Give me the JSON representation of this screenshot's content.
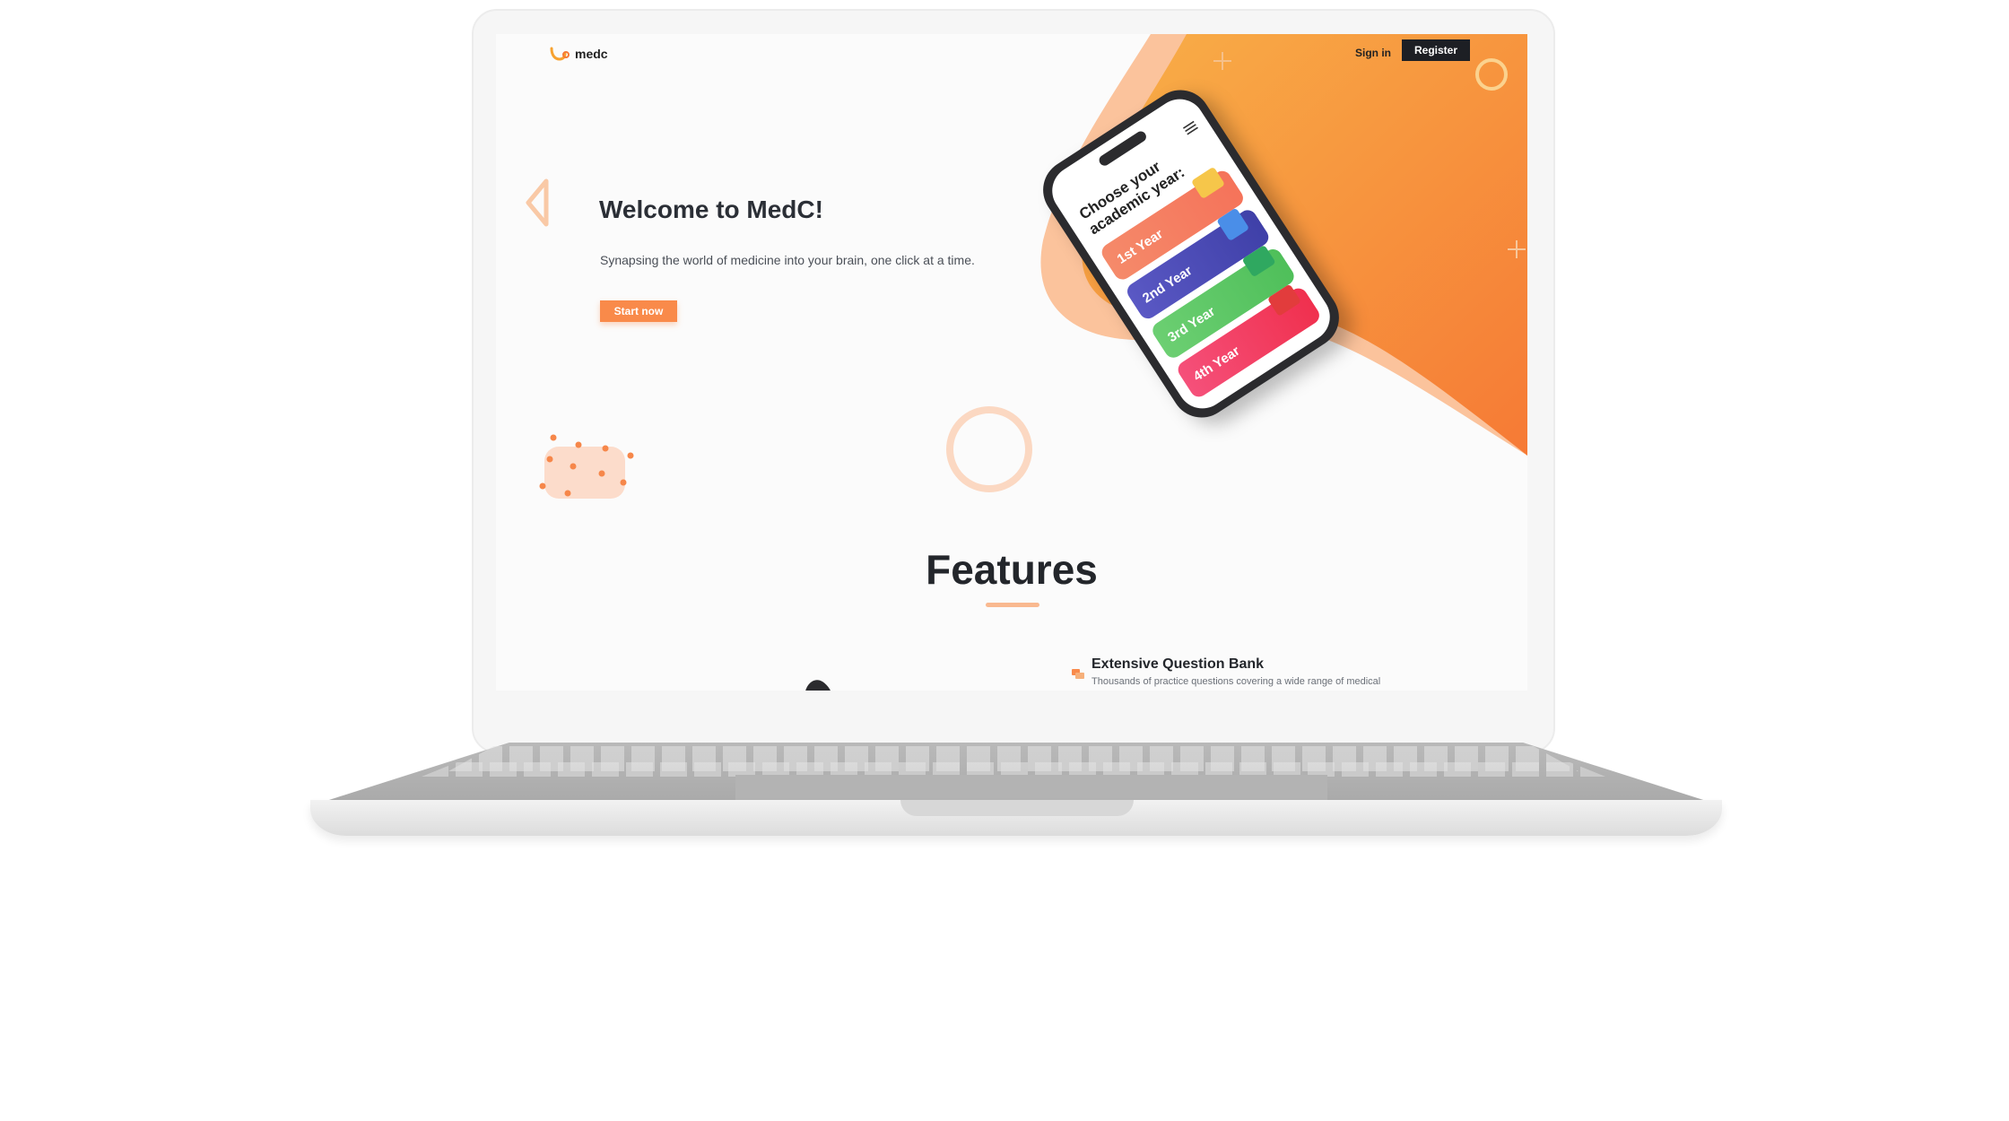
{
  "brand": {
    "name": "medc",
    "accent": "#f98a4a",
    "dark": "#1d1f24"
  },
  "nav": {
    "sign_in": "Sign in",
    "register": "Register"
  },
  "hero": {
    "title": "Welcome to MedC!",
    "subtitle": "Synapsing the world of medicine into your brain, one click at a time.",
    "cta": "Start now"
  },
  "phone": {
    "heading_line1": "Choose your",
    "heading_line2": "academic year:",
    "years": [
      {
        "label": "1st Year",
        "color": "#f5735a"
      },
      {
        "label": "2nd Year",
        "color": "#3f40a8"
      },
      {
        "label": "3rd Year",
        "color": "#4fbf5a"
      },
      {
        "label": "4th Year",
        "color": "#f0304e"
      }
    ]
  },
  "features": {
    "title": "Features",
    "items": [
      {
        "title": "Extensive Question Bank",
        "description": "Thousands of practice questions covering a wide range of medical"
      }
    ]
  }
}
